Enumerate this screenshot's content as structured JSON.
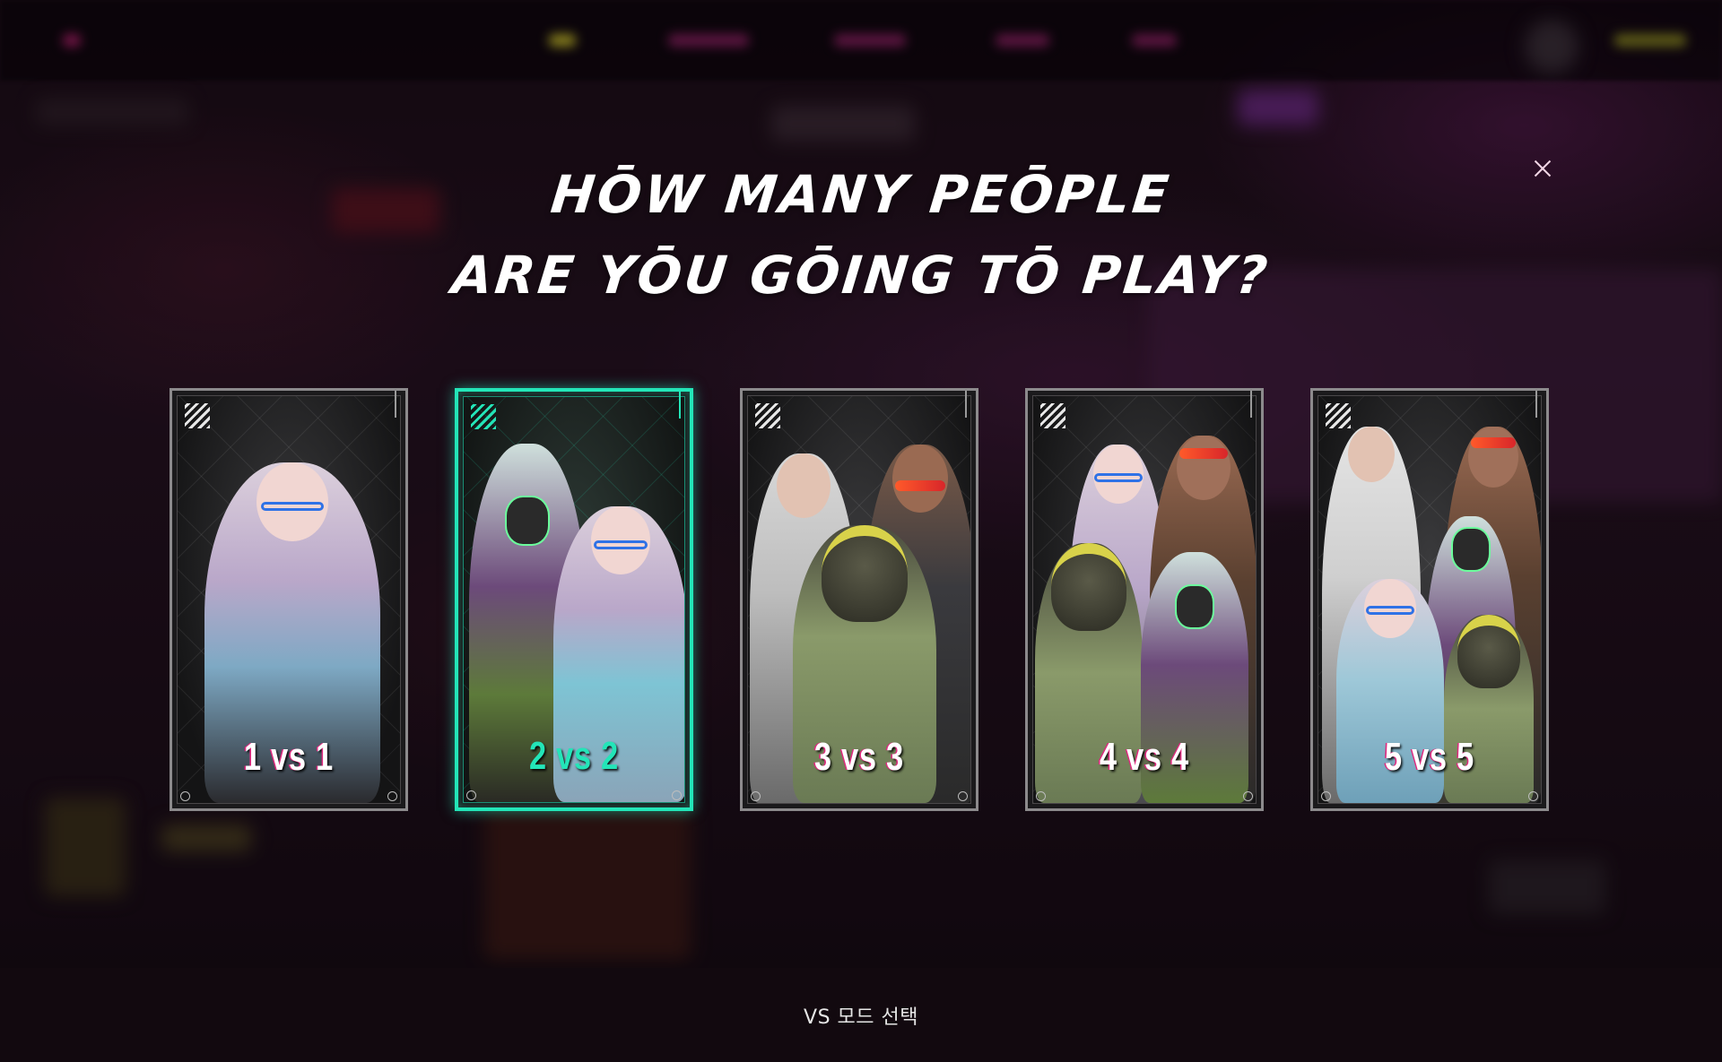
{
  "dialog": {
    "title_line1": "HŌW MANY PEŌPLE",
    "title_line2": "ARE YŌU GŌING TŌ PLAY?",
    "close_icon": "close-icon"
  },
  "modes": [
    {
      "label": "1 vs 1",
      "selected": false
    },
    {
      "label": "2 vs 2",
      "selected": true
    },
    {
      "label": "3 vs 3",
      "selected": false
    },
    {
      "label": "4 vs 4",
      "selected": false
    },
    {
      "label": "5 vs 5",
      "selected": false
    }
  ],
  "footer": {
    "caption": "VS 모드 선택"
  },
  "colors": {
    "accent_selected": "#23e5b8",
    "label_shadow": "#e0287f",
    "card_border": "#8c8a8c",
    "background": "#1c0e18"
  }
}
